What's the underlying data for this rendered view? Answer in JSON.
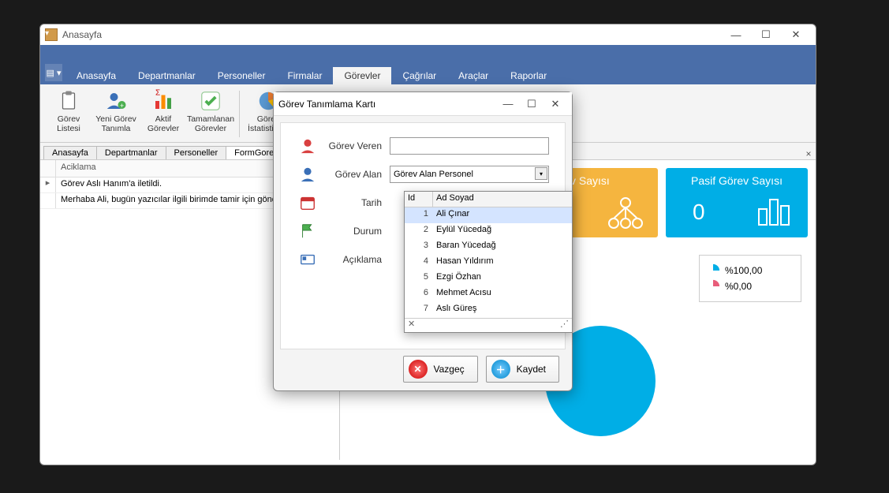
{
  "main": {
    "title": "Anasayfa",
    "menu": [
      "Anasayfa",
      "Departmanlar",
      "Personeller",
      "Firmalar",
      "Görevler",
      "Çağrılar",
      "Araçlar",
      "Raporlar"
    ],
    "active_menu_index": 4
  },
  "ribbon": [
    {
      "label": "Görev\nListesi",
      "icon": "clipboard"
    },
    {
      "label": "Yeni Görev\nTanımla",
      "icon": "person-add"
    },
    {
      "label": "Aktif\nGörevler",
      "icon": "bars"
    },
    {
      "label": "Tamamlanan\nGörevler",
      "icon": "check"
    },
    {
      "sep": true
    },
    {
      "label": "Görev\nİstatistikleri",
      "icon": "pie"
    }
  ],
  "doc_tabs": [
    "Anasayfa",
    "Departmanlar",
    "Personeller",
    "FormGorevListesi"
  ],
  "active_doc_tab_index": 3,
  "grid": {
    "header": "Aciklama",
    "rows": [
      {
        "marker": "▸",
        "text": "Görev Aslı Hanım'a iletildi."
      },
      {
        "marker": "",
        "text": "Merhaba Ali, bugün yazıcılar ilgili birimde tamir için gönder"
      }
    ]
  },
  "stats": {
    "orange": {
      "title": "ev Sayısı"
    },
    "blue": {
      "title": "Pasif Görev Sayısı",
      "value": "0"
    }
  },
  "legend": [
    {
      "color": "#00aee6",
      "label": "%100,00"
    },
    {
      "color": "#e85d7a",
      "label": "%0,00"
    }
  ],
  "dialog": {
    "title": "Görev Tanımlama Kartı",
    "fields": {
      "gorev_veren": {
        "label": "Görev Veren",
        "value": ""
      },
      "gorev_alan": {
        "label": "Görev Alan",
        "value": "Görev Alan Personel"
      },
      "tarih": {
        "label": "Tarih"
      },
      "durum": {
        "label": "Durum"
      },
      "aciklama": {
        "label": "Açıklama"
      }
    },
    "dropdown": {
      "cols": [
        "Id",
        "Ad Soyad"
      ],
      "selected": 0,
      "rows": [
        {
          "id": 1,
          "name": "Ali Çınar"
        },
        {
          "id": 2,
          "name": "Eylül Yücedağ"
        },
        {
          "id": 3,
          "name": "Baran Yücedağ"
        },
        {
          "id": 4,
          "name": "Hasan Yıldırım"
        },
        {
          "id": 5,
          "name": "Ezgi Özhan"
        },
        {
          "id": 6,
          "name": "Mehmet Acısu"
        },
        {
          "id": 7,
          "name": "Aslı Güreş"
        }
      ]
    },
    "buttons": {
      "cancel": "Vazgeç",
      "save": "Kaydet"
    }
  }
}
